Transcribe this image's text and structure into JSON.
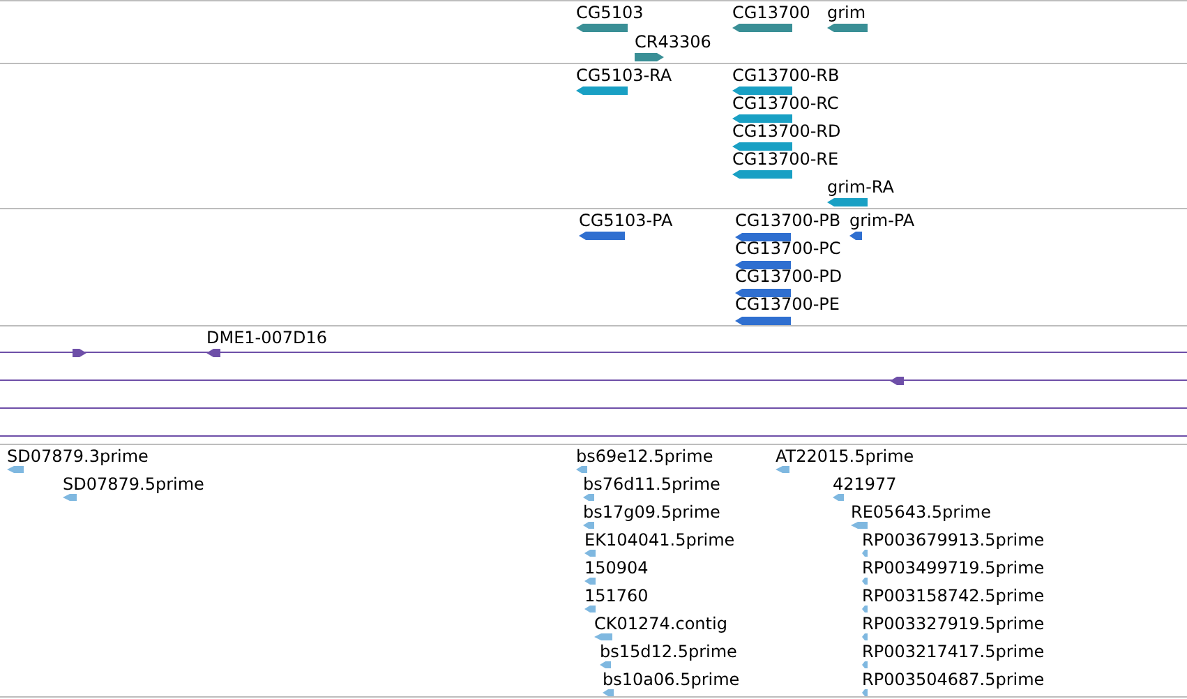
{
  "tracks": [
    {
      "kind": "gene",
      "features": [
        {
          "label": "CG5103",
          "reverse": true
        },
        {
          "label": "CR43306",
          "reverse": false
        },
        {
          "label": "CG13700",
          "reverse": true
        },
        {
          "label": "grim",
          "reverse": true
        }
      ]
    },
    {
      "kind": "transcript",
      "features": [
        {
          "label": "CG5103-RA",
          "reverse": true
        },
        {
          "label": "CG13700-RB",
          "reverse": true
        },
        {
          "label": "CG13700-RC",
          "reverse": true
        },
        {
          "label": "CG13700-RD",
          "reverse": true
        },
        {
          "label": "CG13700-RE",
          "reverse": true
        },
        {
          "label": "grim-RA",
          "reverse": true
        }
      ]
    },
    {
      "kind": "protein",
      "features": [
        {
          "label": "CG5103-PA",
          "reverse": true
        },
        {
          "label": "CG13700-PB",
          "reverse": true
        },
        {
          "label": "grim-PA",
          "reverse": true
        },
        {
          "label": "CG13700-PC",
          "reverse": true
        },
        {
          "label": "CG13700-PD",
          "reverse": true
        },
        {
          "label": "CG13700-PE",
          "reverse": true
        }
      ]
    },
    {
      "kind": "clone",
      "features": [
        {
          "reverse": false
        },
        {
          "label": "DME1-007D16",
          "reverse": true
        },
        {
          "reverse": true
        }
      ]
    },
    {
      "kind": "est",
      "features": [
        {
          "label": "SD07879.3prime",
          "reverse": true
        },
        {
          "label": "SD07879.5prime",
          "reverse": true
        },
        {
          "label": "bs69e12.5prime",
          "reverse": true
        },
        {
          "label": "bs76d11.5prime",
          "reverse": true
        },
        {
          "label": "bs17g09.5prime",
          "reverse": true
        },
        {
          "label": "EK104041.5prime",
          "reverse": true
        },
        {
          "label": "150904",
          "reverse": true
        },
        {
          "label": "151760",
          "reverse": true
        },
        {
          "label": "CK01274.contig",
          "reverse": true
        },
        {
          "label": "bs15d12.5prime",
          "reverse": true
        },
        {
          "label": "bs10a06.5prime",
          "reverse": true
        },
        {
          "label": "AT22015.5prime",
          "reverse": true
        },
        {
          "label": "421977",
          "reverse": true
        },
        {
          "label": "RE05643.5prime",
          "reverse": true
        },
        {
          "label": "RP003679913.5prime",
          "reverse": true
        },
        {
          "label": "RP003499719.5prime",
          "reverse": true
        },
        {
          "label": "RP003158742.5prime",
          "reverse": true
        },
        {
          "label": "RP003327919.5prime",
          "reverse": true
        },
        {
          "label": "RP003217417.5prime",
          "reverse": true
        },
        {
          "label": "RP003504687.5prime",
          "reverse": true
        }
      ]
    }
  ]
}
